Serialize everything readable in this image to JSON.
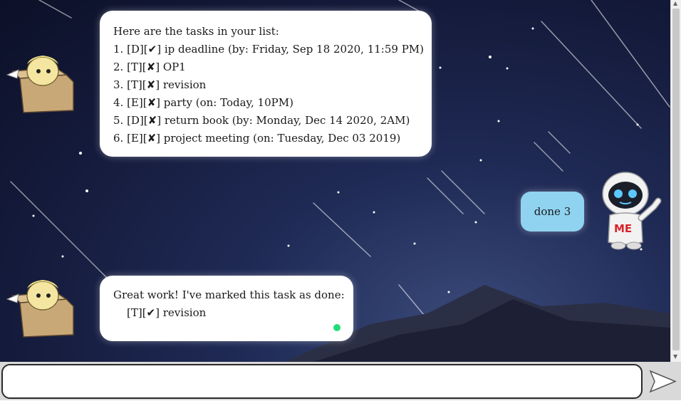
{
  "messages": [
    {
      "sender": "duke",
      "lines": [
        "Here are the tasks in your list:",
        "1. [D][✔] ip deadline (by: Friday, Sep 18 2020, 11:59 PM)",
        "2. [T][✘] OP1",
        "3. [T][✘] revision",
        "4. [E][✘] party (on: Today, 10PM)",
        "5. [D][✘] return book (by: Monday, Dec 14 2020, 2AM)",
        "6. [E][✘] project meeting (on: Tuesday, Dec 03 2019)"
      ]
    },
    {
      "sender": "user",
      "text": "done 3"
    },
    {
      "sender": "duke",
      "lines": [
        "Great work! I've marked this task as done:",
        "[T][✔] revision"
      ]
    }
  ],
  "input": {
    "value": "",
    "placeholder": ""
  },
  "icons": {
    "bot_avatar": "box-character-avatar",
    "user_avatar": "robot-avatar",
    "send": "send-arrow-icon",
    "status": "online-dot-icon"
  },
  "colors": {
    "user_bubble": "#8fd3f0",
    "bot_bubble": "#ffffff",
    "status_dot": "#22dd77",
    "send_arrow": "#ffffff"
  }
}
